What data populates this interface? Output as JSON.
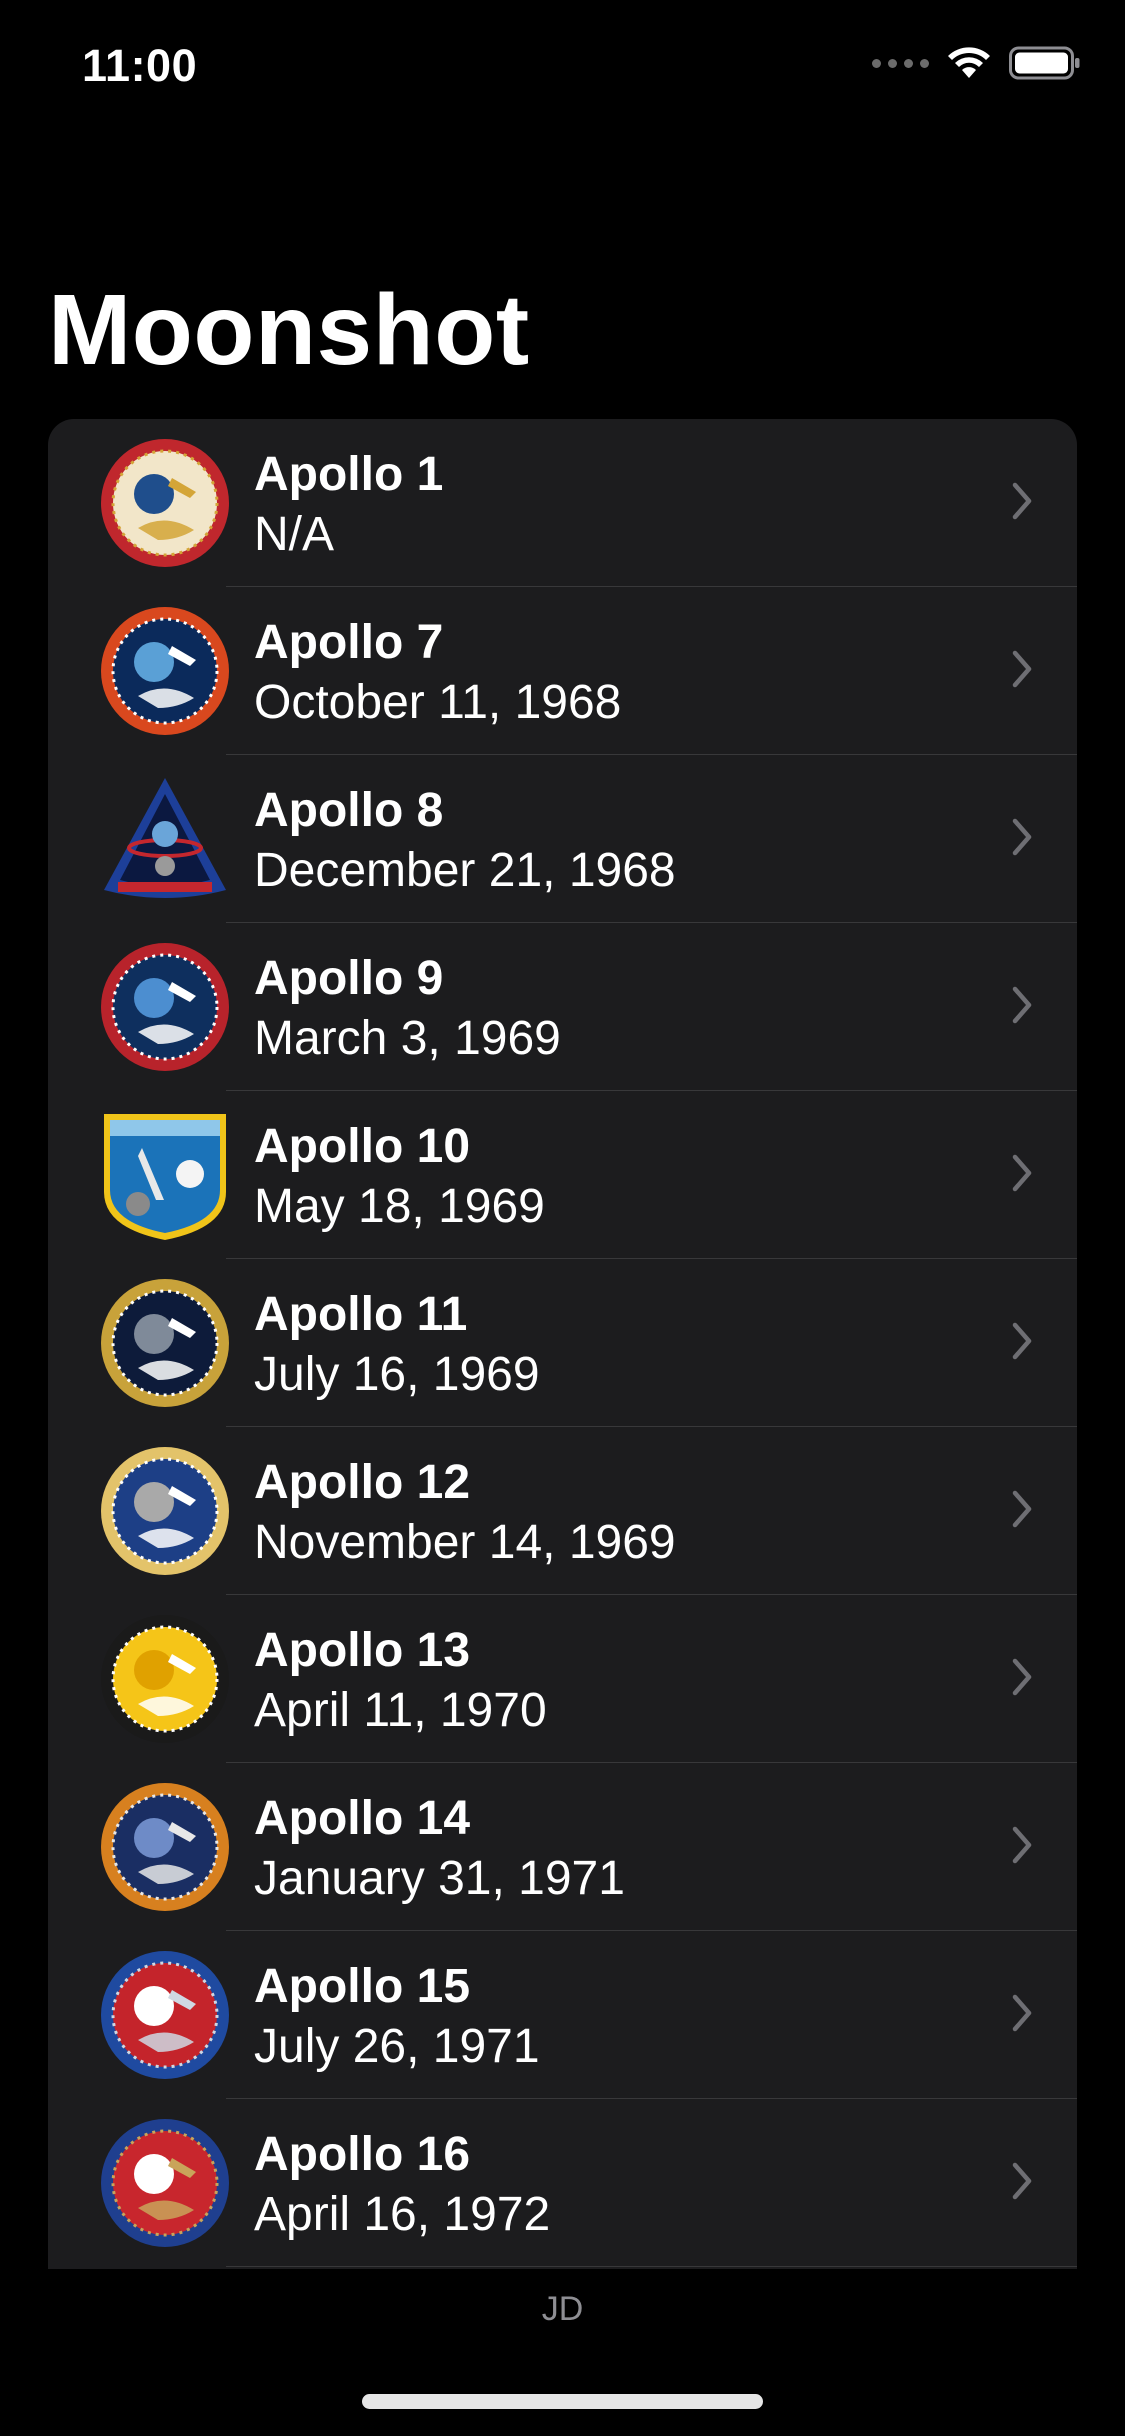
{
  "status_bar": {
    "time": "11:00",
    "icons": [
      "cellular-signal-icon",
      "wifi-icon",
      "battery-icon"
    ]
  },
  "nav": {
    "title": "Moonshot"
  },
  "missions": [
    {
      "name": "Apollo 1",
      "date": "N/A",
      "badge": "apollo-1-badge-icon",
      "colors": [
        "#c0272d",
        "#f2e6c9",
        "#1f4e8c",
        "#d4a537"
      ]
    },
    {
      "name": "Apollo 7",
      "date": "October 11, 1968",
      "badge": "apollo-7-badge-icon",
      "colors": [
        "#d9481e",
        "#0b2a5b",
        "#5aa0d6",
        "#ffffff"
      ]
    },
    {
      "name": "Apollo 8",
      "date": "December 21, 1968",
      "badge": "apollo-8-badge-icon",
      "colors": [
        "#1d3f99",
        "#c4272e",
        "#6aa5d9",
        "#ffffff"
      ]
    },
    {
      "name": "Apollo 9",
      "date": "March 3, 1969",
      "badge": "apollo-9-badge-icon",
      "colors": [
        "#b8232b",
        "#0e2f5e",
        "#4c8ed0",
        "#ffffff"
      ]
    },
    {
      "name": "Apollo 10",
      "date": "May 18, 1969",
      "badge": "apollo-10-badge-icon",
      "colors": [
        "#f0c419",
        "#1b73b9",
        "#8fc7ea",
        "#ffffff"
      ]
    },
    {
      "name": "Apollo 11",
      "date": "July 16, 1969",
      "badge": "apollo-11-badge-icon",
      "colors": [
        "#c8a23a",
        "#0d1b3a",
        "#7f8a99",
        "#ffffff"
      ]
    },
    {
      "name": "Apollo 12",
      "date": "November 14, 1969",
      "badge": "apollo-12-badge-icon",
      "colors": [
        "#e3c36a",
        "#1d3f86",
        "#a9a9a9",
        "#ffffff"
      ]
    },
    {
      "name": "Apollo 13",
      "date": "April 11, 1970",
      "badge": "apollo-13-badge-icon",
      "colors": [
        "#1a1a1a",
        "#f5c518",
        "#e0a100",
        "#ffffff"
      ]
    },
    {
      "name": "Apollo 14",
      "date": "January 31, 1971",
      "badge": "apollo-14-badge-icon",
      "colors": [
        "#d7801f",
        "#1a2e63",
        "#6e8bc7",
        "#e8e8e8"
      ]
    },
    {
      "name": "Apollo 15",
      "date": "July 26, 1971",
      "badge": "apollo-15-badge-icon",
      "colors": [
        "#1f4aa0",
        "#c4242b",
        "#ffffff",
        "#cfd8e3"
      ]
    },
    {
      "name": "Apollo 16",
      "date": "April 16, 1972",
      "badge": "apollo-16-badge-icon",
      "colors": [
        "#1f3f8f",
        "#c8262d",
        "#ffffff",
        "#c9a45a"
      ]
    }
  ],
  "footer": {
    "initials": "JD"
  }
}
